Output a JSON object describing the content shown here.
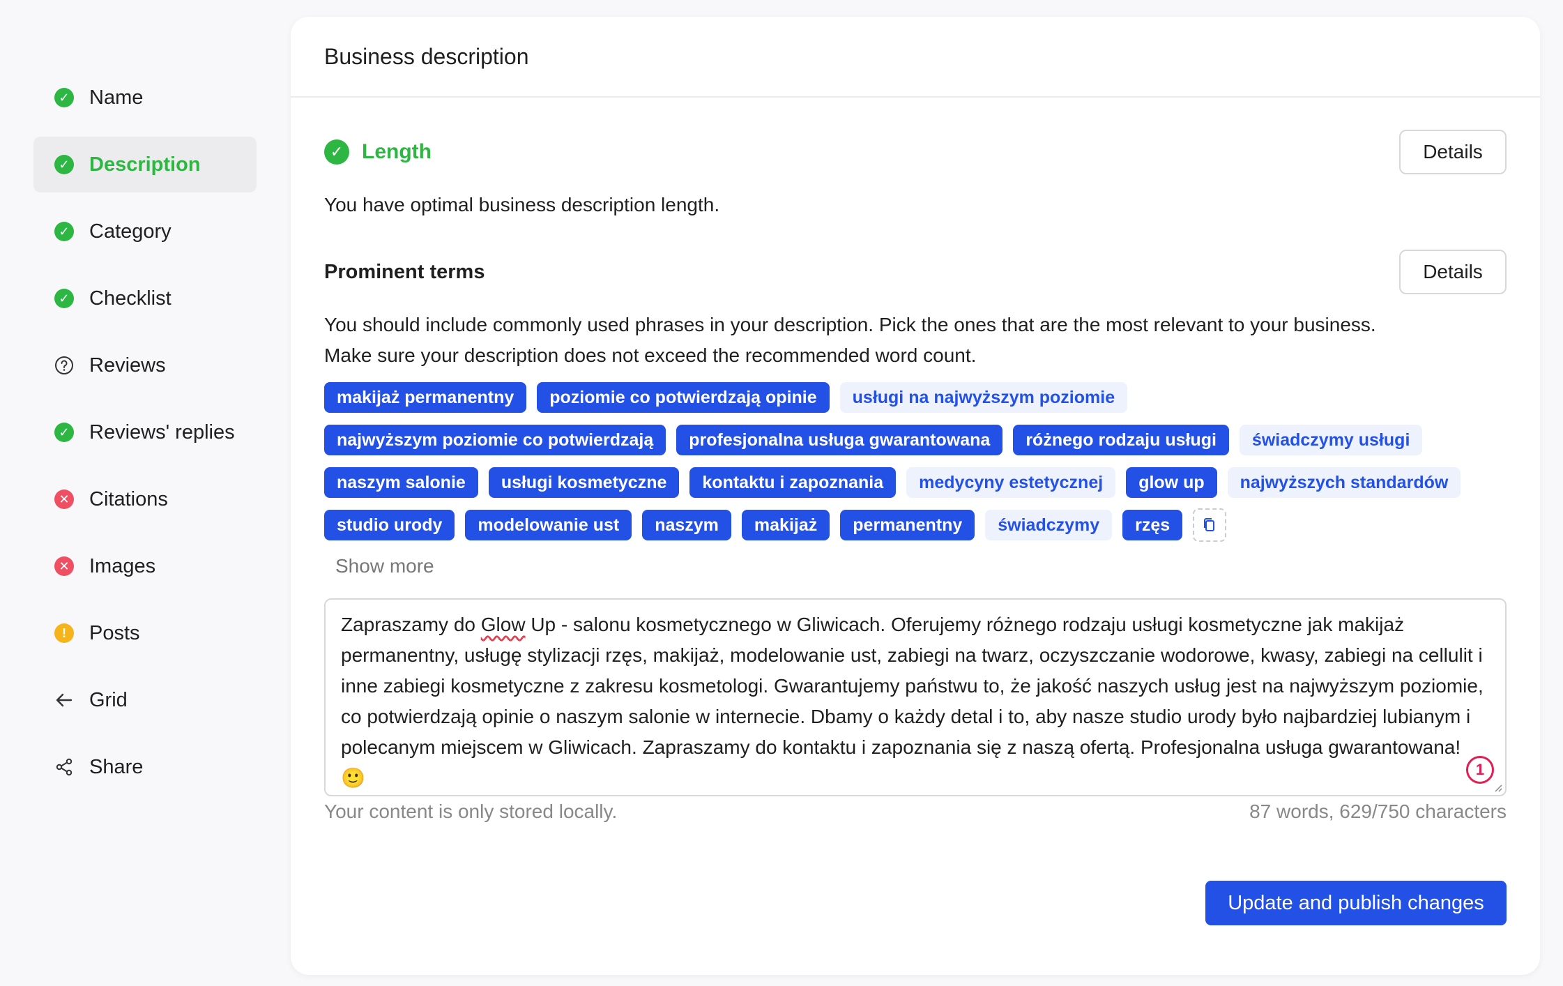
{
  "sidebar": {
    "items": [
      {
        "label": "Name",
        "status": "ok"
      },
      {
        "label": "Description",
        "status": "ok",
        "active": true
      },
      {
        "label": "Category",
        "status": "ok"
      },
      {
        "label": "Checklist",
        "status": "ok"
      },
      {
        "label": "Reviews",
        "status": "help"
      },
      {
        "label": "Reviews' replies",
        "status": "ok"
      },
      {
        "label": "Citations",
        "status": "error"
      },
      {
        "label": "Images",
        "status": "error"
      },
      {
        "label": "Posts",
        "status": "warning"
      },
      {
        "label": "Grid",
        "status": "back"
      },
      {
        "label": "Share",
        "status": "share"
      }
    ]
  },
  "card": {
    "title": "Business description",
    "length": {
      "label": "Length",
      "details": "Details",
      "text": "You have optimal business description length."
    },
    "terms": {
      "title": "Prominent terms",
      "details": "Details",
      "text_line1": "You should include commonly used phrases in your description. Pick the ones that are the most relevant to your business.",
      "text_line2": "Make sure your description does not exceed the recommended word count.",
      "rows": [
        [
          {
            "label": "makijaż permanentny",
            "selected": true
          },
          {
            "label": "poziomie co potwierdzają opinie",
            "selected": true
          },
          {
            "label": "usługi na najwyższym poziomie",
            "selected": false
          }
        ],
        [
          {
            "label": "najwyższym poziomie co potwierdzają",
            "selected": true
          },
          {
            "label": "profesjonalna usługa gwarantowana",
            "selected": true
          },
          {
            "label": "różnego rodzaju usługi",
            "selected": true
          },
          {
            "label": "świadczymy usługi",
            "selected": false
          }
        ],
        [
          {
            "label": "naszym salonie",
            "selected": true
          },
          {
            "label": "usługi kosmetyczne",
            "selected": true
          },
          {
            "label": "kontaktu i zapoznania",
            "selected": true
          },
          {
            "label": "medycyny estetycznej",
            "selected": false
          },
          {
            "label": "glow up",
            "selected": true
          },
          {
            "label": "najwyższych standardów",
            "selected": false
          }
        ],
        [
          {
            "label": "studio urody",
            "selected": true
          },
          {
            "label": "modelowanie ust",
            "selected": true
          },
          {
            "label": "naszym",
            "selected": true
          },
          {
            "label": "makijaż",
            "selected": true
          },
          {
            "label": "permanentny",
            "selected": true
          },
          {
            "label": "świadczymy",
            "selected": false
          },
          {
            "label": "rzęs",
            "selected": true
          }
        ]
      ],
      "show_more": "Show more"
    },
    "description": {
      "before_glow": "Zapraszamy do ",
      "glow": "Glow",
      "after_glow": " Up - salonu kosmetycznego w Gliwicach. Oferujemy różnego rodzaju usługi kosmetyczne jak makijaż permanentny, usługę stylizacji rzęs, makijaż, modelowanie ust, zabiegi na twarz, oczyszczanie wodorowe, kwasy, zabiegi na cellulit i inne zabiegi kosmetyczne z zakresu kosmetologi. Gwarantujemy państwu to, że jakość naszych usług jest na najwyższym poziomie, co potwierdzają opinie o naszym salonie w internecie. Dbamy o każdy detal i to, aby nasze studio urody było najbardziej lubianym i polecanym miejscem w Gliwicach. Zapraszamy do kontaktu i zapoznania się z naszą ofertą. Profesjonalna usługa gwarantowana! 🙂",
      "badge": "1"
    },
    "storage_note": "Your content is only stored locally.",
    "count": "87 words, 629/750 characters",
    "publish": "Update and publish changes"
  },
  "colors": {
    "accent": "#2351e5",
    "success": "#2db742",
    "error": "#ef4f63",
    "warning": "#f6b41c"
  }
}
